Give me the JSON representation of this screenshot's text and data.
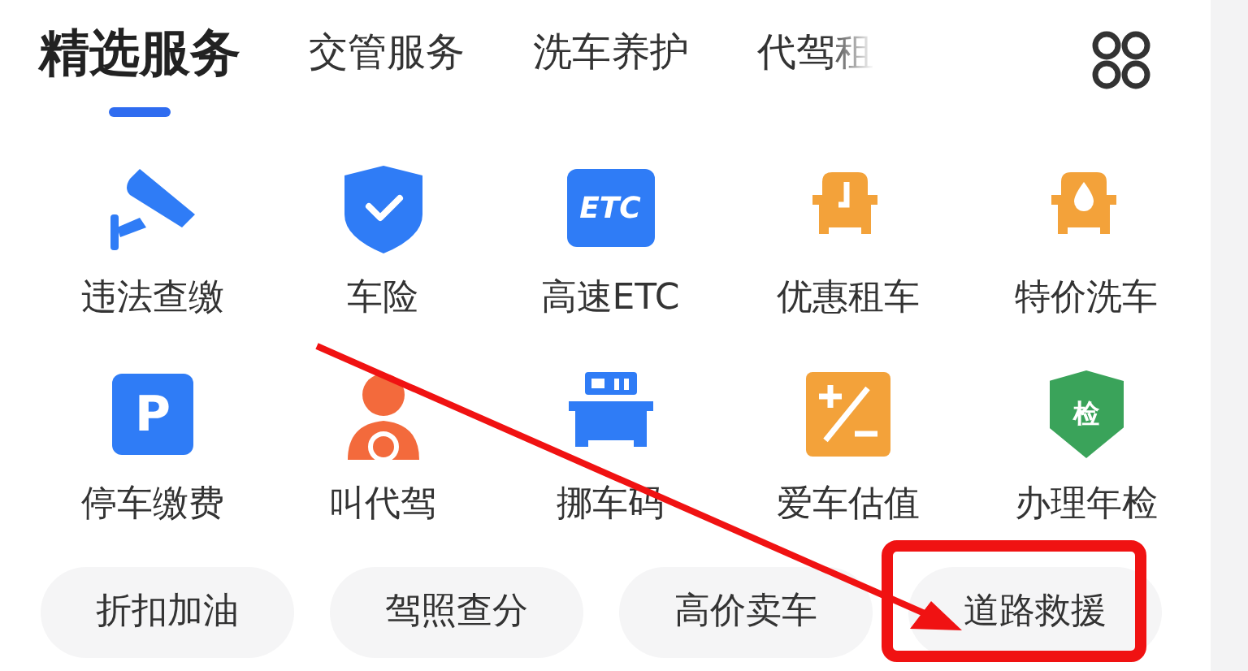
{
  "tabs": [
    {
      "label": "精选服务",
      "selected": true
    },
    {
      "label": "交管服务",
      "selected": false
    },
    {
      "label": "洗车养护",
      "selected": false
    },
    {
      "label": "代驾租",
      "selected": false
    }
  ],
  "services": [
    {
      "label": "违法查缴",
      "kind": "camera"
    },
    {
      "label": "车险",
      "kind": "shield"
    },
    {
      "label": "高速ETC",
      "kind": "tag",
      "icon_text": "ETC"
    },
    {
      "label": "优惠租车",
      "kind": "car-clock"
    },
    {
      "label": "特价洗车",
      "kind": "car-drop"
    },
    {
      "label": "停车缴费",
      "kind": "square",
      "icon_text": "P"
    },
    {
      "label": "叫代驾",
      "kind": "driver"
    },
    {
      "label": "挪车码",
      "kind": "car-sign"
    },
    {
      "label": "爱车估值",
      "kind": "plus-minus"
    },
    {
      "label": "办理年检",
      "kind": "badge",
      "icon_text": "检"
    }
  ],
  "quick_links": [
    "折扣加油",
    "驾照查分",
    "高价卖车",
    "道路救援"
  ]
}
